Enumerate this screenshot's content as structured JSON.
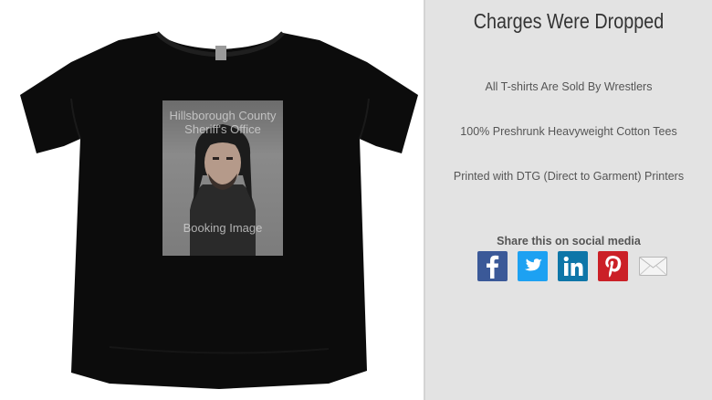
{
  "product": {
    "title": "Charges Were Dropped",
    "features": [
      "All T-shirts Are Sold By Wrestlers",
      "100% Preshrunk Heavyweight Cotton Tees",
      "Printed with DTG (Direct to Garment) Printers"
    ]
  },
  "shirt_print": {
    "agency_line1": "Hillsborough County",
    "agency_line2": "Sheriff's Office",
    "caption": "Booking Image"
  },
  "share": {
    "heading": "Share this on social media",
    "buttons": [
      {
        "name": "facebook",
        "icon": "facebook-icon",
        "color": "#3b5998"
      },
      {
        "name": "twitter",
        "icon": "twitter-icon",
        "color": "#1da1f2"
      },
      {
        "name": "linkedin",
        "icon": "linkedin-icon",
        "color": "#0e76a8"
      },
      {
        "name": "pinterest",
        "icon": "pinterest-icon",
        "color": "#cb2027"
      },
      {
        "name": "email",
        "icon": "envelope-icon",
        "color": "#e0e0e0"
      }
    ]
  },
  "colors": {
    "page_background": "#e3e3e3",
    "shirt": "#0c0c0c",
    "title_text": "#333333",
    "body_text": "#555555"
  }
}
